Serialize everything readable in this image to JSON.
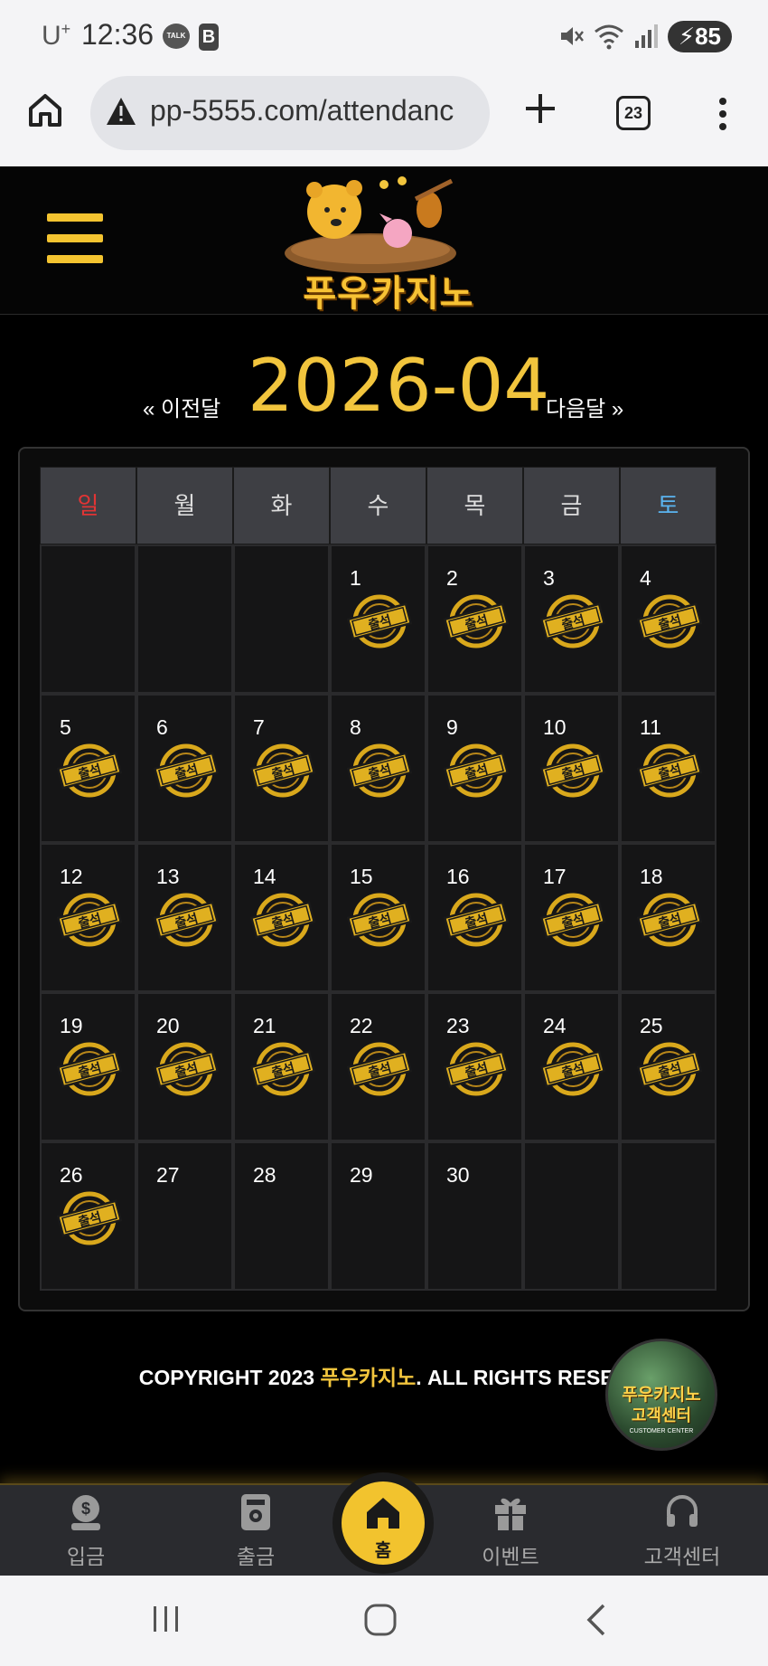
{
  "status_bar": {
    "carrier": "U",
    "carrier_sup": "+",
    "time": "12:36",
    "talk_label": "TALK",
    "b_label": "B",
    "battery": "85"
  },
  "browser": {
    "url": "pp-5555.com/attendanc",
    "tab_count": "23"
  },
  "site": {
    "logo_text": "푸우카지노"
  },
  "month_nav": {
    "prev": "« 이전달",
    "title": "2026-04",
    "next": "다음달 »"
  },
  "calendar": {
    "weekdays": [
      "일",
      "월",
      "화",
      "수",
      "목",
      "금",
      "토"
    ],
    "weeks": [
      [
        {
          "day": "",
          "stamp": false
        },
        {
          "day": "",
          "stamp": false
        },
        {
          "day": "",
          "stamp": false
        },
        {
          "day": "1",
          "stamp": true
        },
        {
          "day": "2",
          "stamp": true
        },
        {
          "day": "3",
          "stamp": true
        },
        {
          "day": "4",
          "stamp": true
        }
      ],
      [
        {
          "day": "5",
          "stamp": true
        },
        {
          "day": "6",
          "stamp": true
        },
        {
          "day": "7",
          "stamp": true
        },
        {
          "day": "8",
          "stamp": true
        },
        {
          "day": "9",
          "stamp": true
        },
        {
          "day": "10",
          "stamp": true
        },
        {
          "day": "11",
          "stamp": true
        }
      ],
      [
        {
          "day": "12",
          "stamp": true
        },
        {
          "day": "13",
          "stamp": true
        },
        {
          "day": "14",
          "stamp": true
        },
        {
          "day": "15",
          "stamp": true
        },
        {
          "day": "16",
          "stamp": true
        },
        {
          "day": "17",
          "stamp": true
        },
        {
          "day": "18",
          "stamp": true
        }
      ],
      [
        {
          "day": "19",
          "stamp": true
        },
        {
          "day": "20",
          "stamp": true
        },
        {
          "day": "21",
          "stamp": true
        },
        {
          "day": "22",
          "stamp": true
        },
        {
          "day": "23",
          "stamp": true
        },
        {
          "day": "24",
          "stamp": true
        },
        {
          "day": "25",
          "stamp": true
        }
      ],
      [
        {
          "day": "26",
          "stamp": true
        },
        {
          "day": "27",
          "stamp": false
        },
        {
          "day": "28",
          "stamp": false
        },
        {
          "day": "29",
          "stamp": false
        },
        {
          "day": "30",
          "stamp": false
        },
        {
          "day": "",
          "stamp": false
        },
        {
          "day": "",
          "stamp": false
        }
      ]
    ],
    "stamp_label": "출석"
  },
  "footer": {
    "copyright_pre": "COPYRIGHT 2023 ",
    "copyright_brand": "푸우카지노",
    "copyright_post": ". ALL RIGHTS RESER",
    "cs_badge_line1": "푸우카지노",
    "cs_badge_line2": "고객센터",
    "cs_badge_line3": "CUSTOMER CENTER"
  },
  "bottom_nav": {
    "deposit": "입금",
    "withdraw": "출금",
    "home": "홈",
    "event": "이벤트",
    "support": "고객센터"
  },
  "colors": {
    "accent": "#f2c53d",
    "sunday": "#e23434",
    "saturday": "#5ab4f0",
    "background": "#000000"
  }
}
